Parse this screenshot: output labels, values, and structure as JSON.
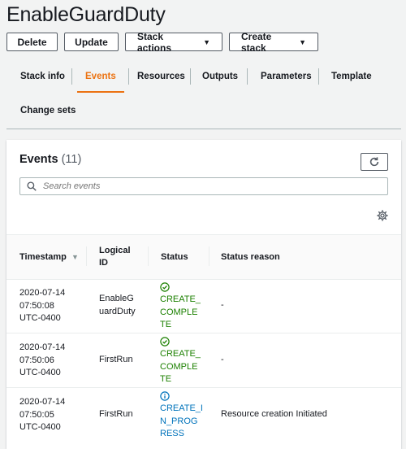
{
  "page": {
    "title": "EnableGuardDuty"
  },
  "actions": {
    "delete": "Delete",
    "update": "Update",
    "stack_actions": "Stack actions",
    "create_stack": "Create stack"
  },
  "tabs": [
    {
      "label": "Stack info"
    },
    {
      "label": "Events"
    },
    {
      "label": "Resources"
    },
    {
      "label": "Outputs"
    },
    {
      "label": "Parameters"
    },
    {
      "label": "Template"
    },
    {
      "label": "Change sets"
    }
  ],
  "active_tab": "Events",
  "events": {
    "heading": "Events",
    "count": "(11)",
    "search_placeholder": "Search events",
    "columns": {
      "timestamp": "Timestamp",
      "logical_id_1": "Logical",
      "logical_id_2": "ID",
      "status": "Status",
      "reason": "Status reason"
    },
    "rows": [
      {
        "ts": [
          "2020-07-14",
          "07:50:08",
          "UTC-0400"
        ],
        "logical": [
          "EnableG",
          "uardDuty"
        ],
        "status": [
          "CREATE_",
          "COMPLE",
          "TE"
        ],
        "status_kind": "complete",
        "reason": "-"
      },
      {
        "ts": [
          "2020-07-14",
          "07:50:06",
          "UTC-0400"
        ],
        "logical": [
          "FirstRun"
        ],
        "status": [
          "CREATE_",
          "COMPLE",
          "TE"
        ],
        "status_kind": "complete",
        "reason": "-"
      },
      {
        "ts": [
          "2020-07-14",
          "07:50:05",
          "UTC-0400"
        ],
        "logical": [
          "FirstRun"
        ],
        "status": [
          "CREATE_I",
          "N_PROG",
          "RESS"
        ],
        "status_kind": "in-progress",
        "reason": "Resource creation Initiated"
      }
    ]
  },
  "colors": {
    "accent": "#ec7211",
    "success": "#1d8102",
    "info": "#0073bb"
  }
}
